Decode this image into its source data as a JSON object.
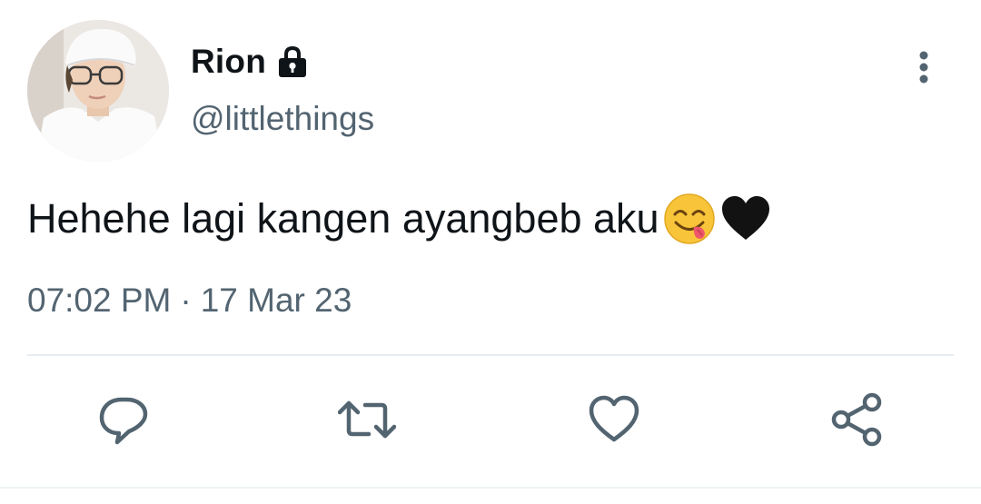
{
  "user": {
    "display_name": "Rion",
    "handle": "@littlethings",
    "locked_icon": "lock-icon"
  },
  "tweet": {
    "text": "Hehehe lagi kangen ayangbeb aku",
    "emojis": [
      "face-savoring-food-emoji",
      "black-heart-emoji"
    ],
    "time": "07:02 PM",
    "separator": "·",
    "date": "17 Mar 23"
  },
  "actions": [
    {
      "icon": "reply-icon"
    },
    {
      "icon": "retweet-icon"
    },
    {
      "icon": "like-icon"
    },
    {
      "icon": "share-icon"
    }
  ],
  "colors": {
    "text_primary": "#0f1419",
    "text_secondary": "#536471",
    "icon": "#536471",
    "divider": "#e6ecf0"
  }
}
